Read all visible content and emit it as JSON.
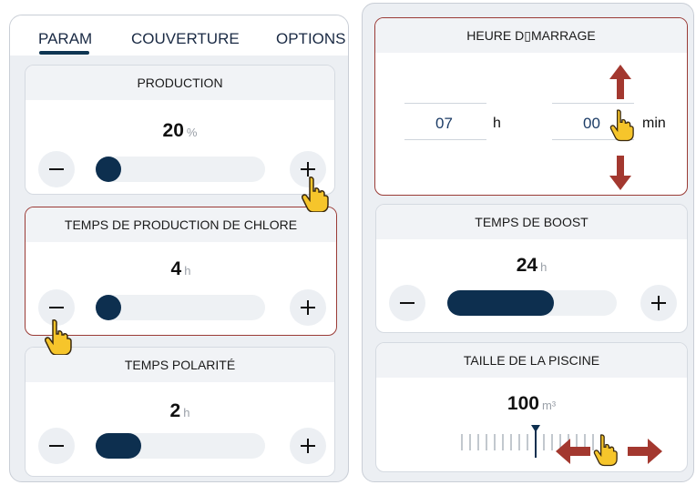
{
  "tabs": [
    {
      "label": "PARAM",
      "active": true
    },
    {
      "label": "COUVERTURE",
      "active": false
    },
    {
      "label": "OPTIONS",
      "active": false
    }
  ],
  "production": {
    "title": "PRODUCTION",
    "value": "20",
    "unit": "%",
    "level": 0.05
  },
  "chlorine_time": {
    "title": "TEMPS DE PRODUCTION DE CHLORE",
    "value": "4",
    "unit": "h",
    "level": 0.05
  },
  "polarity_time": {
    "title": "TEMPS POLARITÉ",
    "value": "2",
    "unit": "h",
    "level": 0.27
  },
  "start_time": {
    "title": "HEURE D▯MARRAGE",
    "hour": "07",
    "hour_unit": "h",
    "minute": "00",
    "minute_unit": "min"
  },
  "boost_time": {
    "title": "TEMPS DE BOOST",
    "value": "24",
    "unit": "h",
    "level": 0.63
  },
  "pool_size": {
    "title": "TAILLE DE LA PISCINE",
    "value": "100",
    "unit": "m³"
  },
  "colors": {
    "accent_dark": "#0d2f4f",
    "highlight_border": "#9a3b36",
    "arrow_red": "#a3382f",
    "hand_yellow": "#f6c52b"
  }
}
